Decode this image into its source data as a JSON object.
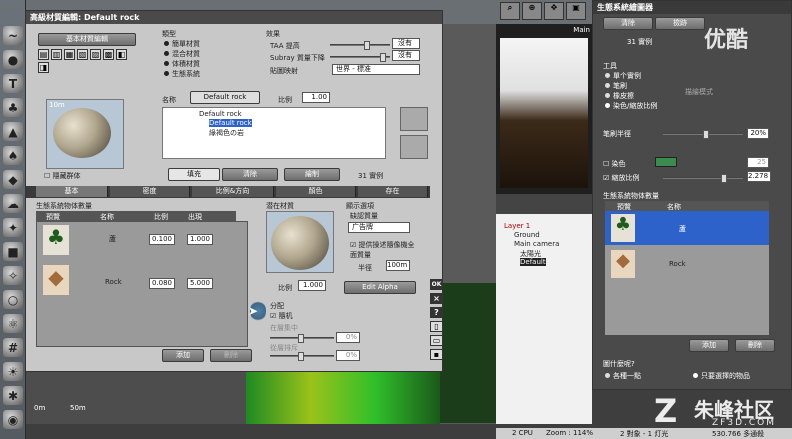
{
  "material_editor": {
    "title": "高級材質編輯: Default rock",
    "basic_btn": "基本材質編輯",
    "type_label": "類型",
    "type_options": [
      "簡單材質",
      "混合材質",
      "体積材質",
      "生態系統"
    ],
    "effects_label": "效果",
    "taa_label": "TAA 提高",
    "taa_value": "沒有",
    "subray_label": "Subray 質量下降",
    "subray_value": "沒有",
    "map_label": "貼圖映射",
    "map_value": "世界 - 標准",
    "hide_eco": "隱藏群体",
    "name_label": "名称",
    "name_value": "Default rock",
    "scale_label": "比例",
    "scale_value": "1.00",
    "tree_items": [
      "Default rock",
      "Default rock",
      "綠褐色の岩"
    ],
    "btn_fill": "填充",
    "btn_clear": "清除",
    "btn_paint": "繪制",
    "instances": "31 實例",
    "tabs": [
      "基本",
      "密度",
      "比例&方向",
      "顏色",
      "存在"
    ],
    "objects_header": "生態系統物体數量",
    "col_preview": "預覽",
    "col_name": "名称",
    "col_scale": "比例",
    "col_output": "出現",
    "rows": [
      {
        "name": "蘆",
        "scale": "0.100",
        "output": "1.000"
      },
      {
        "name": "Rock",
        "scale": "0.080",
        "output": "5.000"
      }
    ],
    "btn_add": "添加",
    "btn_remove": "刪除",
    "latent_label": "潜在材質",
    "latent_scale_label": "比例",
    "latent_scale": "1.000",
    "display_label": "顯示選項",
    "default_quality": "缺認質量",
    "display_select": "广告牌",
    "chk_text": "提供操述隨像機全面質量",
    "radius_label": "半徑",
    "radius_value": "100m",
    "edit_alpha": "Edit Alpha",
    "distrib_label": "分配",
    "random_label": "隨机",
    "gather_label": "在層集中",
    "gather_value": "0%",
    "layer_label": "從層排斥",
    "layer_value": "0%",
    "ok": "OK",
    "preview_size": "10m"
  },
  "eco_painter": {
    "title": "生態系統繪圖器",
    "btn_clear": "清除",
    "btn_select": "撿跡",
    "instances": "31 實例",
    "tools_label": "工具",
    "tool_options": [
      "單个實例",
      "笔刷",
      "橡皮擦",
      "染色/縮放比例"
    ],
    "mode_label": "描繪模式",
    "brush_label": "笔刷半徑",
    "brush_value": "20%",
    "color_label": "染色",
    "color_value": "25",
    "scale_label": "縮放比例",
    "scale_value": "2.278",
    "objects_header": "生態系統物体數量",
    "col_preview": "預覽",
    "col_name": "名称",
    "rows": [
      {
        "name": "蘆"
      },
      {
        "name": "Rock"
      }
    ],
    "btn_add": "添加",
    "btn_remove": "刪除",
    "paint_where": "圖什麼呢?",
    "opt_all": "各種一點",
    "opt_selected": "只要選擇的物品"
  },
  "scene": {
    "viewport_label": "Main",
    "items": [
      "Layer 1",
      "Ground",
      "Main camera",
      "太陽光",
      "Default"
    ],
    "scale_bar_a": "0m",
    "scale_bar_b": "50m"
  },
  "status": {
    "cpu": "2 CPU",
    "zoom": "Zoom : 114%",
    "objects": "2 對象 - 1 灯光",
    "coords": "530.766 多通殺"
  },
  "watermark": {
    "top": "优酷",
    "site": "朱峰社区",
    "url": "ZF3D.COM"
  },
  "colors": {
    "selection": "#2c62c9",
    "green_swatch": "#3b8a4e"
  }
}
